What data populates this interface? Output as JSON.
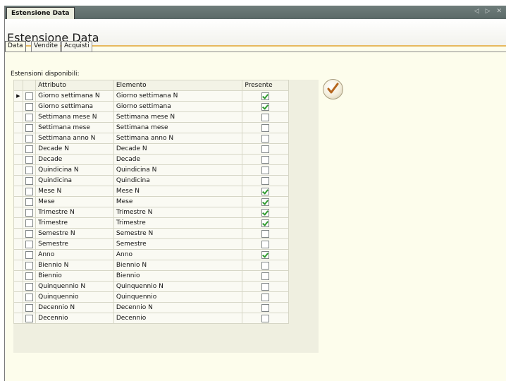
{
  "window": {
    "doc_tab": "Estensione Data",
    "nav_arrows": "◁ ▷ ✕",
    "page_title": "Estensione Data"
  },
  "tabs": [
    {
      "label": "Data",
      "active": true
    },
    {
      "label": "Vendite",
      "active": false
    },
    {
      "label": "Acquisti",
      "active": false
    }
  ],
  "caption": "Estensioni disponibili:",
  "grid": {
    "headers": {
      "attributo": "Attributo",
      "elemento": "Elemento",
      "presente": "Presente"
    },
    "rows": [
      {
        "selected": false,
        "attributo": "Giorno settimana N",
        "elemento": "Giorno settimana N",
        "presente": true
      },
      {
        "selected": false,
        "attributo": "Giorno settimana",
        "elemento": "Giorno settimana",
        "presente": true
      },
      {
        "selected": false,
        "attributo": "Settimana mese N",
        "elemento": "Settimana mese N",
        "presente": false
      },
      {
        "selected": false,
        "attributo": "Settimana mese",
        "elemento": "Settimana mese",
        "presente": false
      },
      {
        "selected": false,
        "attributo": "Settimana anno N",
        "elemento": "Settimana anno N",
        "presente": false
      },
      {
        "selected": false,
        "attributo": "Decade N",
        "elemento": "Decade N",
        "presente": false
      },
      {
        "selected": false,
        "attributo": "Decade",
        "elemento": "Decade",
        "presente": false
      },
      {
        "selected": false,
        "attributo": "Quindicina N",
        "elemento": "Quindicina N",
        "presente": false
      },
      {
        "selected": false,
        "attributo": "Quindicina",
        "elemento": "Quindicina",
        "presente": false
      },
      {
        "selected": false,
        "attributo": "Mese N",
        "elemento": "Mese N",
        "presente": true
      },
      {
        "selected": false,
        "attributo": "Mese",
        "elemento": "Mese",
        "presente": true
      },
      {
        "selected": false,
        "attributo": "Trimestre N",
        "elemento": "Trimestre N",
        "presente": true
      },
      {
        "selected": false,
        "attributo": "Trimestre",
        "elemento": "Trimestre",
        "presente": true
      },
      {
        "selected": false,
        "attributo": "Semestre N",
        "elemento": "Semestre N",
        "presente": false
      },
      {
        "selected": false,
        "attributo": "Semestre",
        "elemento": "Semestre",
        "presente": false
      },
      {
        "selected": false,
        "attributo": "Anno",
        "elemento": "Anno",
        "presente": true
      },
      {
        "selected": false,
        "attributo": "Biennio N",
        "elemento": "Biennio N",
        "presente": false
      },
      {
        "selected": false,
        "attributo": "Biennio",
        "elemento": "Biennio",
        "presente": false
      },
      {
        "selected": false,
        "attributo": "Quinquennio N",
        "elemento": "Quinquennio N",
        "presente": false
      },
      {
        "selected": false,
        "attributo": "Quinquennio",
        "elemento": "Quinquennio",
        "presente": false
      },
      {
        "selected": false,
        "attributo": "Decennio N",
        "elemento": "Decennio N",
        "presente": false
      },
      {
        "selected": false,
        "attributo": "Decennio",
        "elemento": "Decennio",
        "presente": false
      }
    ],
    "current_row_index": 0
  },
  "icons": {
    "confirm": "checkmark-icon",
    "row_pointer": "triangle-right-icon"
  },
  "colors": {
    "accent": "#e7b95e",
    "check": "#2e9a2e",
    "confirm_check": "#b5651d"
  }
}
